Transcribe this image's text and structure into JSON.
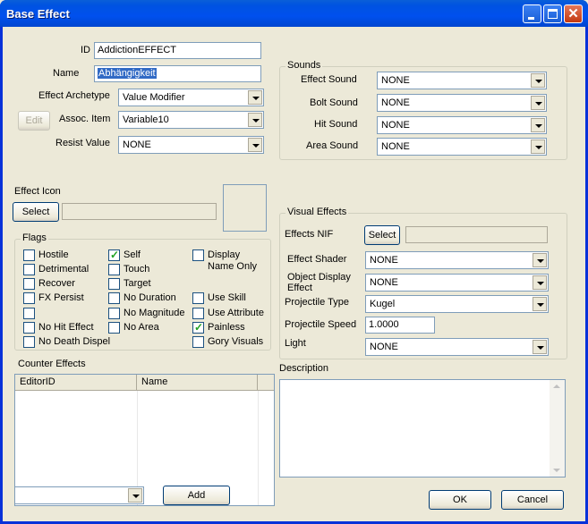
{
  "window": {
    "title": "Base Effect"
  },
  "form": {
    "id_label": "ID",
    "id_value": "AddictionEFFECT",
    "name_label": "Name",
    "name_value": "Abhängigkeit",
    "archetype_label": "Effect Archetype",
    "archetype_value": "Value Modifier",
    "edit_label": "Edit",
    "assoc_label": "Assoc. Item",
    "assoc_value": "Variable10",
    "resist_label": "Resist Value",
    "resist_value": "NONE"
  },
  "sounds": {
    "title": "Sounds",
    "effect_label": "Effect Sound",
    "effect_value": "NONE",
    "bolt_label": "Bolt Sound",
    "bolt_value": "NONE",
    "hit_label": "Hit Sound",
    "hit_value": "NONE",
    "area_label": "Area Sound",
    "area_value": "NONE"
  },
  "icon": {
    "label": "Effect Icon",
    "select_label": "Select",
    "path_value": ""
  },
  "flags": {
    "title": "Flags",
    "hostile": "Hostile",
    "detrimental": "Detrimental",
    "recover": "Recover",
    "fx_persist": "FX Persist",
    "no_hit_effect": "No Hit Effect",
    "no_death_dispel": "No Death Dispel",
    "self": "Self",
    "touch": "Touch",
    "target": "Target",
    "no_duration": "No Duration",
    "no_magnitude": "No Magnitude",
    "no_area": "No Area",
    "display_name_only_1": "Display",
    "display_name_only_2": "Name Only",
    "use_skill": "Use Skill",
    "use_attribute": "Use Attribute",
    "painless": "Painless",
    "gory_visuals": "Gory Visuals"
  },
  "visual": {
    "title": "Visual Effects",
    "nif_label": "Effects NIF",
    "nif_select": "Select",
    "nif_value": "",
    "shader_label": "Effect Shader",
    "shader_value": "NONE",
    "object_label_1": "Object Display",
    "object_label_2": "Effect",
    "object_value": "NONE",
    "proj_type_label": "Projectile Type",
    "proj_type_value": "Kugel",
    "proj_speed_label": "Projectile Speed",
    "proj_speed_value": "1.0000",
    "light_label": "Light",
    "light_value": "NONE"
  },
  "counter": {
    "title": "Counter Effects",
    "columns": [
      "EditorID",
      "Name"
    ],
    "add_label": "Add",
    "combo_value": ""
  },
  "description": {
    "title": "Description",
    "value": ""
  },
  "buttons": {
    "ok": "OK",
    "cancel": "Cancel"
  }
}
